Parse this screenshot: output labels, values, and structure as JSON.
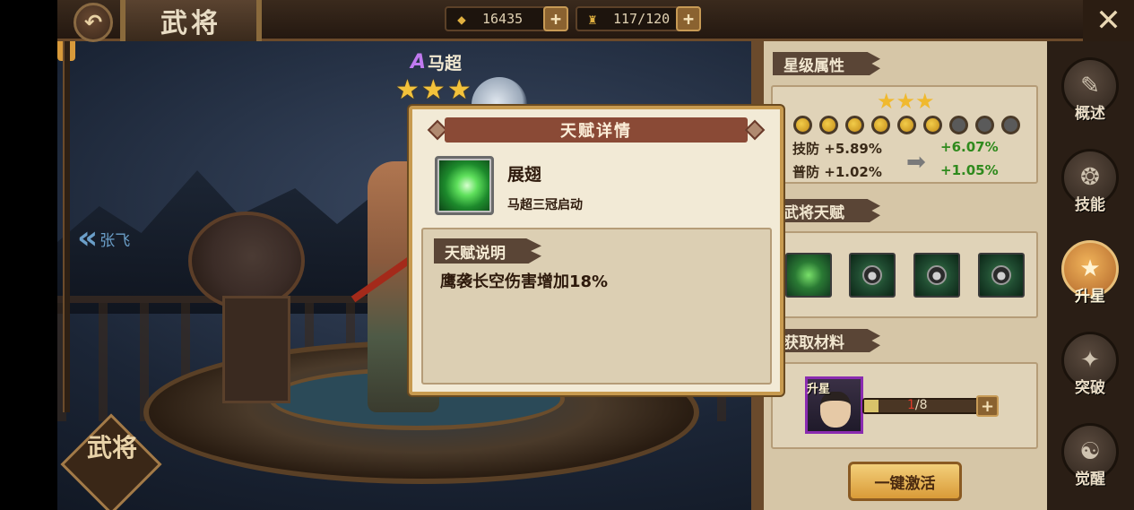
{
  "topbar": {
    "title": "武将",
    "gold": "16435",
    "stamina": "117/120"
  },
  "hero": {
    "grade": "A",
    "name": "马超",
    "stars": [
      "★",
      "★",
      "★"
    ],
    "prev_hero": "张飞"
  },
  "corner_badge": "武将",
  "panel": {
    "star_attr_tag": "星级属性",
    "stars": [
      "★",
      "★",
      "★"
    ],
    "attrs": [
      {
        "label": "技防",
        "value": "+5.89%",
        "next": "+6.07%"
      },
      {
        "label": "普防",
        "value": "+1.02%",
        "next": "+1.05%"
      }
    ],
    "talent_tag": "武将天赋",
    "material_tag": "获取材料",
    "material_label": "升星",
    "material_have": "1",
    "material_need": "/8",
    "material_progress": 0.125,
    "activate_btn": "一键激活"
  },
  "sidenav": [
    {
      "label": "概述",
      "icon": "book-icon"
    },
    {
      "label": "技能",
      "icon": "skill-icon"
    },
    {
      "label": "升星",
      "icon": "star-up-icon"
    },
    {
      "label": "突破",
      "icon": "breakthrough-icon"
    },
    {
      "label": "觉醒",
      "icon": "awaken-icon"
    }
  ],
  "modal": {
    "title": "天赋详情",
    "skill_name": "展翅",
    "skill_condition": "马超三冠启动",
    "desc_tag": "天赋说明",
    "desc_text": "鹰袭长空伤害增加18%"
  },
  "colors": {
    "star_gold": "#f3c23b",
    "up_green": "#2f8a1d",
    "purple_grade": "#c07af0"
  }
}
